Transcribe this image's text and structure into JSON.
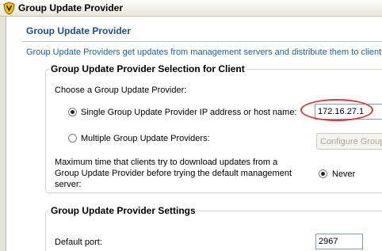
{
  "window": {
    "title": "Group Update Provider"
  },
  "header": {
    "title": "Group Update Provider",
    "description": "Group Update Providers get updates from management servers and distribute them to clients"
  },
  "selection_group": {
    "title": "Group Update Provider Selection for Client",
    "choose_label": "Choose a Group Update Provider:",
    "single_option_label": "Single Group Update Provider IP address or host name:",
    "single_value": "172.16.27.1",
    "multiple_option_label": "Multiple Group Update Providers:",
    "configure_button_label": "Configure Group Update Providers",
    "max_time_label_lines": [
      "Maximum time that clients try to download updates from a",
      "Group Update Provider before trying the default management",
      "server:"
    ],
    "never_label": "Never"
  },
  "settings_group": {
    "title": "Group Update Provider Settings",
    "default_port_label": "Default port:",
    "default_port_value": "2967"
  },
  "colors": {
    "title_blue": "#1f4e8f",
    "desc_blue": "#1f5fa5",
    "highlight": "#d63a3a"
  }
}
